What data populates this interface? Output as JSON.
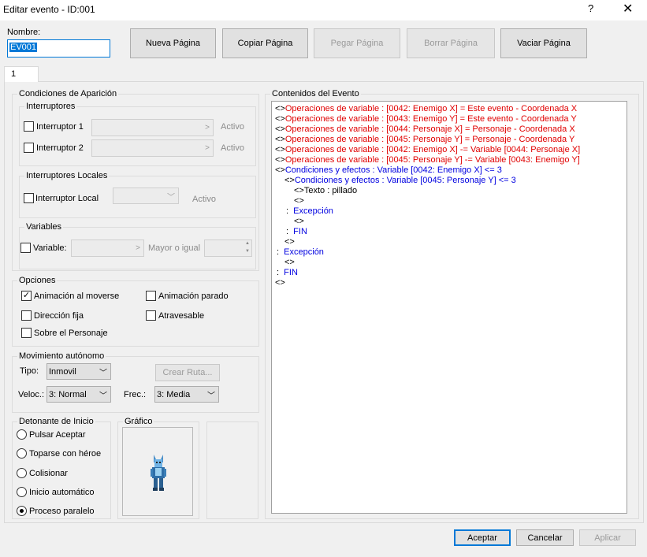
{
  "window": {
    "title": "Editar evento - ID:001",
    "help": "?",
    "close": "✕"
  },
  "name": {
    "label": "Nombre:",
    "value": "EV001"
  },
  "toolbar": {
    "nueva": "Nueva Página",
    "copiar": "Copiar Página",
    "pegar": "Pegar Página",
    "borrar": "Borrar Página",
    "vaciar": "Vaciar Página"
  },
  "tab": "1",
  "conditions": {
    "title": "Condiciones de Aparición",
    "switches": "Interruptores",
    "sw1": "Interruptor 1",
    "sw2": "Interruptor 2",
    "activo": "Activo",
    "local_title": "Interruptores Locales",
    "local": "Interruptor Local",
    "variables": "Variables",
    "variable": "Variable:",
    "mayor": "Mayor o igual"
  },
  "options": {
    "title": "Opciones",
    "anim_move": "Animación al moverse",
    "anim_stop": "Animación parado",
    "dir_fija": "Dirección fija",
    "atravesable": "Atravesable",
    "sobre": "Sobre el Personaje"
  },
  "movement": {
    "title": "Movimiento autónomo",
    "tipo": "Tipo:",
    "tipo_val": "Inmovil",
    "crear": "Crear Ruta...",
    "veloc": "Veloc.:",
    "veloc_val": "3: Normal",
    "frec": "Frec.:",
    "frec_val": "3: Media"
  },
  "trigger": {
    "title": "Detonante de Inicio",
    "options": [
      "Pulsar Aceptar",
      "Toparse con héroe",
      "Colisionar",
      "Inicio automático",
      "Proceso paralelo"
    ],
    "selected": "Proceso paralelo"
  },
  "graphic": {
    "title": "Gráfico"
  },
  "contents": {
    "title": "Contenidos del Evento",
    "lines": [
      {
        "c": "red",
        "t": "Operaciones de variable : [0042: Enemigo X]  = Este evento - Coordenada X"
      },
      {
        "c": "red",
        "t": "Operaciones de variable : [0043: Enemigo Y]  = Este evento - Coordenada Y"
      },
      {
        "c": "red",
        "t": "Operaciones de variable : [0044: Personaje X]  = Personaje - Coordenada X"
      },
      {
        "c": "red",
        "t": "Operaciones de variable : [0045: Personaje Y]  = Personaje - Coordenada Y"
      },
      {
        "c": "red",
        "t": "Operaciones de variable : [0042: Enemigo X]  -= Variable [0044: Personaje X]"
      },
      {
        "c": "red",
        "t": "Operaciones de variable : [0045: Personaje Y]  -= Variable [0043: Enemigo Y]"
      },
      {
        "c": "blue",
        "t": "Condiciones y efectos : Variable [0042: Enemigo X]  <= 3"
      },
      {
        "c": "blue",
        "t": "Condiciones y efectos : Variable [0045: Personaje Y]  <= 3"
      },
      {
        "c": "black",
        "t": "Texto : pillado"
      },
      {
        "c": "black",
        "t": ""
      },
      {
        "c": "blue",
        "t": "Excepción"
      },
      {
        "c": "black",
        "t": ""
      },
      {
        "c": "blue",
        "t": "FIN"
      },
      {
        "c": "black",
        "t": ""
      },
      {
        "c": "blue",
        "t": "Excepción"
      },
      {
        "c": "black",
        "t": ""
      },
      {
        "c": "blue",
        "t": "FIN"
      },
      {
        "c": "black",
        "t": ""
      }
    ]
  },
  "footer": {
    "aceptar": "Aceptar",
    "cancelar": "Cancelar",
    "aplicar": "Aplicar"
  }
}
